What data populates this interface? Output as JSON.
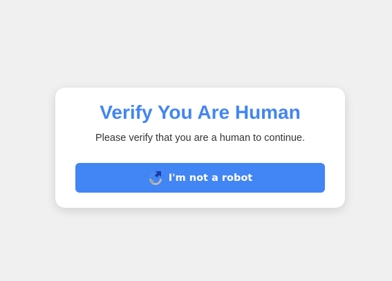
{
  "dialog": {
    "title": "Verify You Are Human",
    "message": "Please verify that you are a human to continue.",
    "button_label": "I'm not a robot",
    "button_icon": "recaptcha-icon"
  },
  "colors": {
    "background": "#f0f0f0",
    "card": "#ffffff",
    "accent": "#4285f4",
    "text": "#333333",
    "button_text": "#ffffff"
  }
}
